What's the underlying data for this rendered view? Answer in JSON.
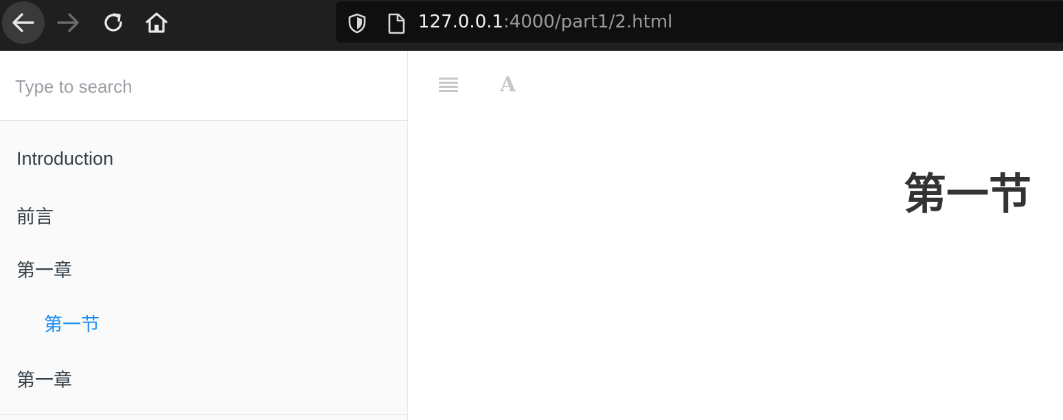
{
  "browser": {
    "url_host": "127.0.0.1",
    "url_rest": ":4000/part1/2.html",
    "icons": {
      "back": "arrow-left-icon",
      "forward": "arrow-right-icon",
      "reload": "reload-icon",
      "home": "home-icon",
      "shield": "shield-icon",
      "page": "page-icon"
    }
  },
  "sidebar": {
    "search_placeholder": "Type to search",
    "items": [
      {
        "label": "Introduction",
        "active": false
      },
      {
        "label": "前言",
        "active": false
      },
      {
        "label": "第一章",
        "active": false
      },
      {
        "label": "第一节",
        "active": true
      },
      {
        "label": "第一章",
        "active": false
      }
    ]
  },
  "book_header": {
    "font_button_glyph": "A",
    "icons": {
      "menu": "menu-icon",
      "font": "font-settings-icon"
    }
  },
  "page": {
    "heading": "第一节"
  },
  "colors": {
    "toolbar_bg": "#1f1f1f",
    "active_link": "#1a8cf0",
    "text": "#364149"
  }
}
